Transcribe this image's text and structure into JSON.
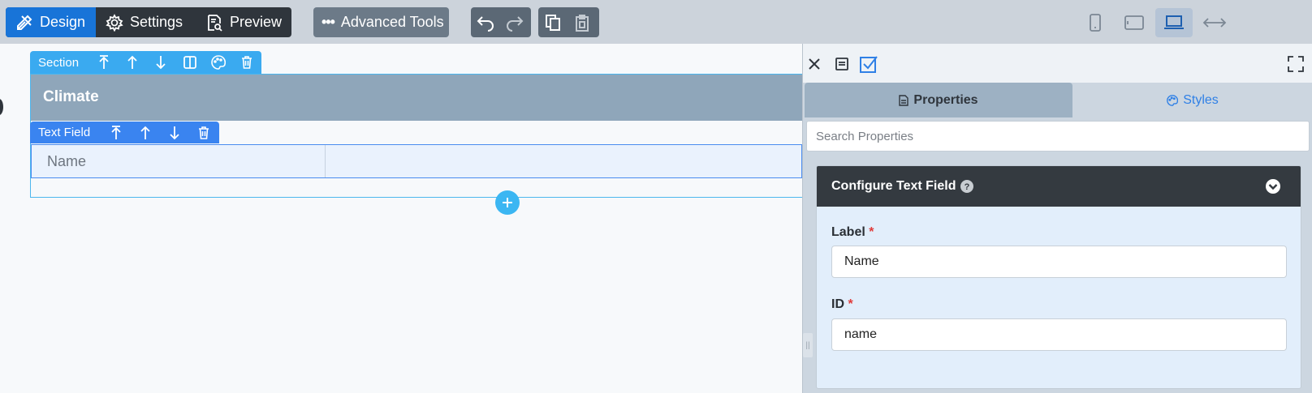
{
  "toolbar": {
    "modes": [
      {
        "label": "Design",
        "icon": "design-tools-icon"
      },
      {
        "label": "Settings",
        "icon": "gear-icon"
      },
      {
        "label": "Preview",
        "icon": "preview-doc-icon"
      }
    ],
    "advanced_label": "Advanced Tools",
    "devices": [
      "phone-icon",
      "tablet-icon",
      "laptop-icon",
      "full-width-icon"
    ],
    "active_device": "laptop"
  },
  "canvas": {
    "section_label": "Section",
    "section_title": "Climate",
    "field_label": "Text Field",
    "field_name": "Name"
  },
  "panel": {
    "tab_properties": "Properties",
    "tab_styles": "Styles",
    "search_placeholder": "Search Properties",
    "config_title": "Configure Text Field",
    "label_field_label": "Label",
    "label_value": "Name",
    "id_field_label": "ID",
    "id_value": "name",
    "required_mark": "*"
  },
  "colors": {
    "accent": "#1874d8",
    "section_toolbar": "#3aaaf0",
    "field_toolbar": "#3a84f0",
    "header_dark": "#343a40"
  }
}
